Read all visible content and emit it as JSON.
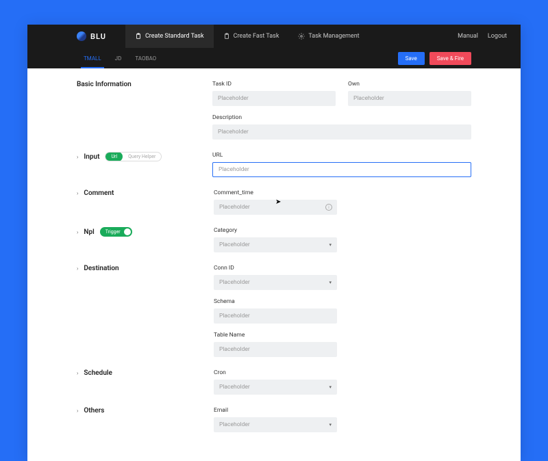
{
  "brand": "BLU",
  "nav": {
    "create_standard": "Create Standard Task",
    "create_fast": "Create Fast Task",
    "task_mgmt": "Task Management",
    "manual": "Manual",
    "logout": "Logout"
  },
  "tabs": {
    "tmall": "TMALL",
    "jd": "JD",
    "taobao": "TAOBAO"
  },
  "buttons": {
    "save": "Save",
    "save_fire": "Save & Fire"
  },
  "sections": {
    "basic": "Basic Information",
    "input": "Input",
    "comment": "Comment",
    "npl": "Npl",
    "destination": "Destination",
    "schedule": "Schedule",
    "others": "Others"
  },
  "pills": {
    "url": "Url",
    "query_helper": "Query Helper",
    "trigger": "Trigger"
  },
  "fields": {
    "task_id": "Task ID",
    "own": "Own",
    "description": "Description",
    "url": "URL",
    "comment_time": "Comment_time",
    "category": "Category",
    "conn_id": "Conn ID",
    "schema": "Schema",
    "table_name": "Table Name",
    "cron": "Cron",
    "email": "Email"
  },
  "placeholder": "Placeholder"
}
